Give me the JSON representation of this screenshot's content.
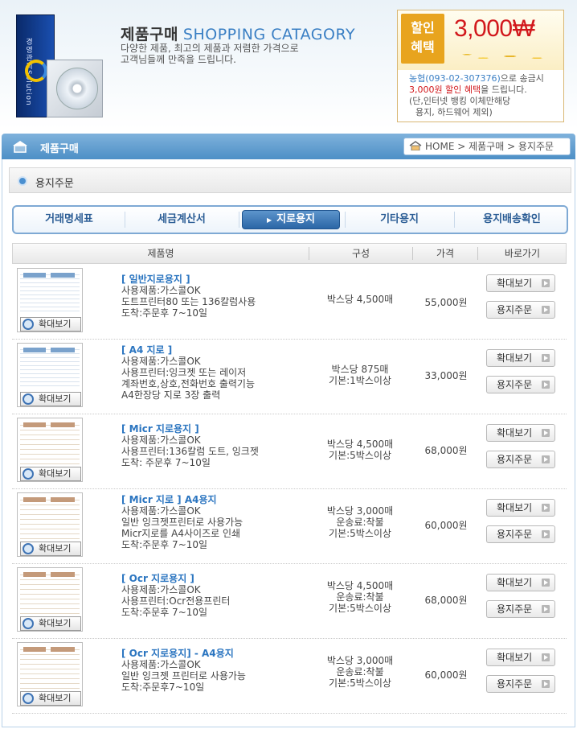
{
  "banner": {
    "box_text": "경영관리Solution",
    "title_kr": "제품구매",
    "title_en": "SHOPPING CATAGORY",
    "desc_line1": "다양한 제품, 최고의 제품과 저렴한 가격으로",
    "desc_line2": "고객님들께 만족을 드립니다."
  },
  "promo": {
    "tag_line1": "할인",
    "tag_line2": "혜택",
    "amount": "3,000₩",
    "bank": "농협(093-02-307376)",
    "text1": "으로 송금시",
    "discount": "3,000원 할인 혜택",
    "text2": "을 드립니다.",
    "note1": "(단,인터넷 뱅킹 이체만해당",
    "note2": "용지, 하드웨어 제외)"
  },
  "title_bar": {
    "title": "제품구매",
    "breadcrumb": "HOME > 제품구매 > 용지주문"
  },
  "section": {
    "title": "용지주문"
  },
  "tabs": [
    "거래명세표",
    "세금계산서",
    "지로용지",
    "기타용지",
    "용지배송확인"
  ],
  "active_tab": 2,
  "table": {
    "headers": [
      "제품명",
      "구성",
      "가격",
      "바로가기"
    ],
    "zoom_label": "확대보기",
    "view_label": "확대보기",
    "order_label": "용지주문"
  },
  "products": [
    {
      "name": "[ 일반지로용지 ]",
      "desc": [
        "사용제품:가스콜OK",
        "도트프린터80 또는 136칼럼사용",
        "도착:주문후 7~10일"
      ],
      "spec": [
        "박스당 4,500매"
      ],
      "price": "55,000원"
    },
    {
      "name": "[ A4 지로 ]",
      "desc": [
        "사용제품:가스콜OK",
        "사용프린터:잉크젯 또는 레이저",
        "계좌번호,상호,전화번호 출력기능",
        "A4한장당 지로 3장 출력"
      ],
      "spec": [
        "박스당 875매",
        "기본:1박스이상"
      ],
      "price": "33,000원"
    },
    {
      "name": "[ Micr 지로용지 ]",
      "desc": [
        "사용제품:가스콜OK",
        "사용프린터:136칼럼 도트, 잉크젯",
        "도착: 주문후 7~10일"
      ],
      "spec": [
        "박스당 4,500매",
        "기본:5박스이상"
      ],
      "price": "68,000원"
    },
    {
      "name": "[ Micr 지로 ] A4용지",
      "desc": [
        "사용제품:가스콜OK",
        "일반 잉크젯프린터로 사용가능",
        "Micr지로를 A4사이즈로 인쇄",
        "도착:주문후 7~10일"
      ],
      "spec": [
        "박스당 3,000매",
        "운송료:착불",
        "기본:5박스이상"
      ],
      "price": "60,000원"
    },
    {
      "name": "[ Ocr 지로용지 ]",
      "desc": [
        "사용제품:가스콜OK",
        "사용프린터:Ocr전용프린터",
        "도착:주문후 7~10일"
      ],
      "spec": [
        "박스당 4,500매",
        "운송료:착불",
        "기본:5박스이상"
      ],
      "price": "68,000원"
    },
    {
      "name": "[ Ocr 지로용지] - A4용지",
      "desc": [
        "사용제품:가스콜OK",
        "일반 잉크젯 프린터로 사용가능",
        "도착:주문후7~10일"
      ],
      "spec": [
        "박스당 3,000매",
        "운송료:착불",
        "기본:5박스이상"
      ],
      "price": "60,000원"
    }
  ]
}
